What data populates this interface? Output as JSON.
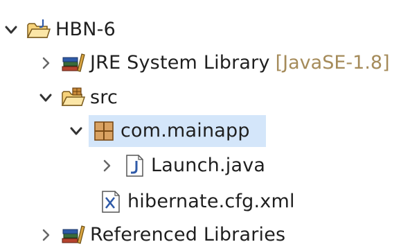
{
  "tree": {
    "project": {
      "label": "HBN-6",
      "icon": "java-project-folder-icon",
      "expanded": true
    },
    "jre": {
      "label": "JRE System Library",
      "decoration": "[JavaSE-1.8]",
      "icon": "library-books-icon",
      "expanded": false
    },
    "src": {
      "label": "src",
      "icon": "source-folder-icon",
      "expanded": true
    },
    "package": {
      "label": "com.mainapp",
      "icon": "package-icon",
      "expanded": true,
      "selected": true
    },
    "launch": {
      "label": "Launch.java",
      "icon": "java-file-icon",
      "expanded": false
    },
    "hibernate": {
      "label": "hibernate.cfg.xml",
      "icon": "xml-file-icon"
    },
    "refs": {
      "label": "Referenced Libraries",
      "icon": "library-books-icon",
      "expanded": false
    }
  },
  "colors": {
    "selection": "#d4e6fa",
    "decoration": "#a58b5a",
    "text": "#1f1f1f"
  }
}
